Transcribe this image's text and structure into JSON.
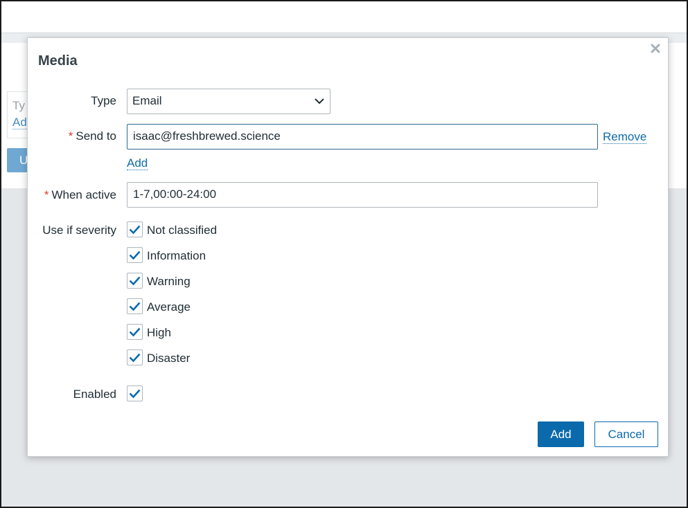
{
  "background": {
    "type_label_partial": "Ty",
    "add_link_partial": "Ad",
    "button_partial": "U"
  },
  "dialog": {
    "title": "Media",
    "close_icon": "close-icon",
    "fields": {
      "type": {
        "label": "Type",
        "value": "Email"
      },
      "send_to": {
        "label": "Send to",
        "required_mark": "*",
        "value": "isaac@freshbrewed.science",
        "remove_label": "Remove",
        "add_label": "Add"
      },
      "when_active": {
        "label": "When active",
        "required_mark": "*",
        "value": "1-7,00:00-24:00"
      },
      "severity": {
        "label": "Use if severity",
        "items": [
          {
            "label": "Not classified",
            "checked": true
          },
          {
            "label": "Information",
            "checked": true
          },
          {
            "label": "Warning",
            "checked": true
          },
          {
            "label": "Average",
            "checked": true
          },
          {
            "label": "High",
            "checked": true
          },
          {
            "label": "Disaster",
            "checked": true
          }
        ]
      },
      "enabled": {
        "label": "Enabled",
        "checked": true
      }
    },
    "buttons": {
      "add": "Add",
      "cancel": "Cancel"
    }
  },
  "colors": {
    "accent": "#0b6aac",
    "link": "#0f6ca7",
    "required": "#e33b2e",
    "check": "#0b6aac"
  }
}
